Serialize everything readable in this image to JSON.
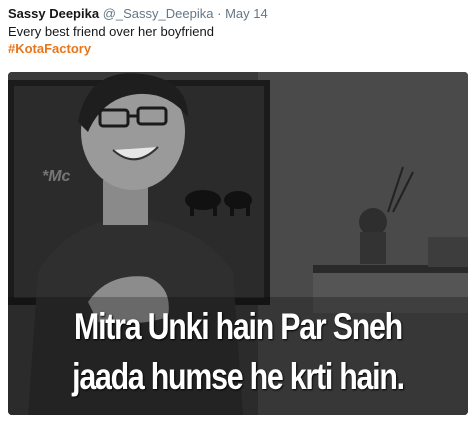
{
  "tweet": {
    "display_name": "Sassy Deepika",
    "handle": "@_Sassy_Deepika",
    "separator": "·",
    "date": "May 14",
    "text": "Every best friend over her boyfriend",
    "hashtag": "#KotaFactory"
  },
  "image": {
    "caption_line1": "Mitra Unki hain Par Sneh",
    "caption_line2": "jaada humse he krti hain.",
    "watermark": "*Mc"
  }
}
